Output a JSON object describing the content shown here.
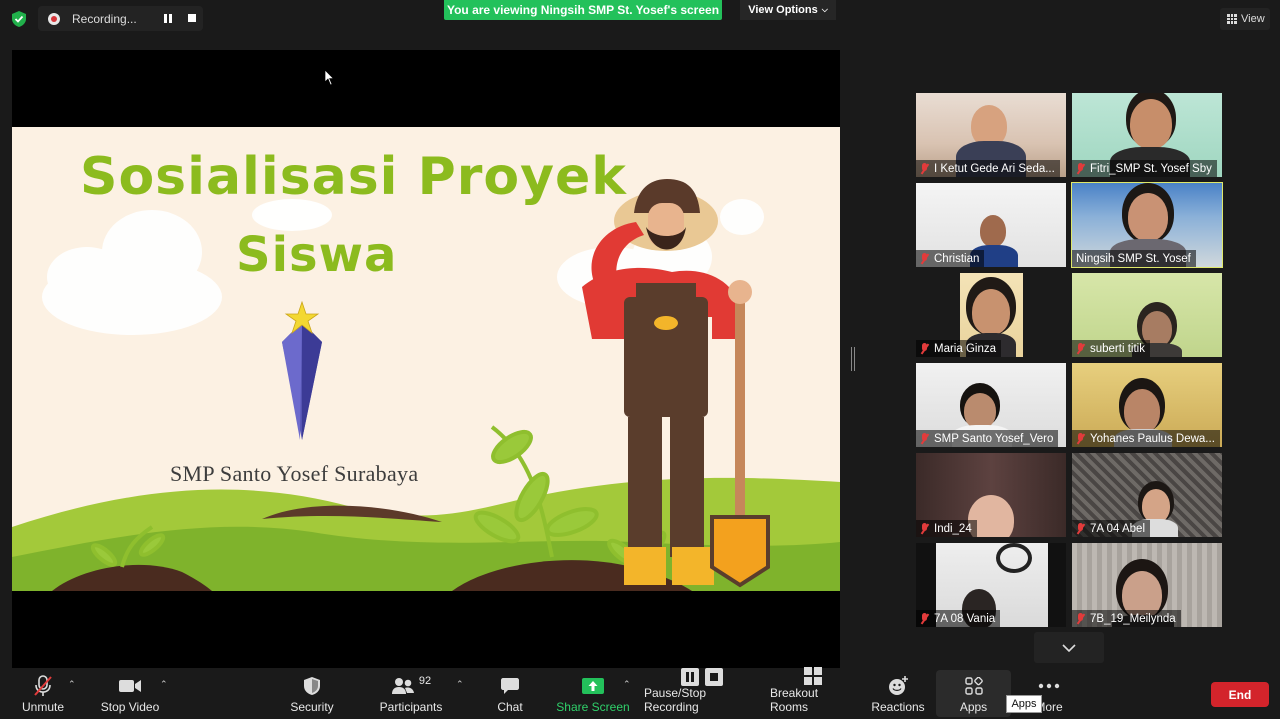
{
  "top": {
    "recording_label": "Recording...",
    "viewing_banner": "You are viewing Ningsih SMP St. Yosef's screen",
    "view_options": "View Options",
    "view_button": "View"
  },
  "slide": {
    "title_line1": "Sosialisasi Proyek",
    "title_line2": "Siswa",
    "school": "SMP Santo Yosef Surabaya"
  },
  "participants": [
    {
      "name": "I Ketut Gede Ari Seda...",
      "muted": true
    },
    {
      "name": "Fitri_SMP St. Yosef Sby",
      "muted": true
    },
    {
      "name": "Christian",
      "muted": true
    },
    {
      "name": "Ningsih SMP St. Yosef",
      "muted": false,
      "active": true
    },
    {
      "name": "Maria Ginza",
      "muted": true
    },
    {
      "name": "suberti titik",
      "muted": true
    },
    {
      "name": "SMP Santo Yosef_Vero",
      "muted": true
    },
    {
      "name": "Yohanes Paulus Dewa...",
      "muted": true
    },
    {
      "name": "Indi_24",
      "muted": true
    },
    {
      "name": "7A 04 Abel",
      "muted": true
    },
    {
      "name": "7A 08 Vania",
      "muted": true
    },
    {
      "name": "7B_19_Meilynda",
      "muted": true
    }
  ],
  "toolbar": {
    "unmute": "Unmute",
    "stop_video": "Stop Video",
    "security": "Security",
    "participants": "Participants",
    "participants_count": "92",
    "chat": "Chat",
    "share_screen": "Share Screen",
    "pause_stop_recording": "Pause/Stop Recording",
    "breakout_rooms": "Breakout Rooms",
    "reactions": "Reactions",
    "apps": "Apps",
    "more": "More",
    "apps_tooltip": "Apps",
    "end": "End"
  },
  "colors": {
    "green_banner": "#23c15b",
    "end_red": "#d3242b",
    "active_outline": "#dfe86a",
    "slide_title": "#8cbb1e"
  }
}
